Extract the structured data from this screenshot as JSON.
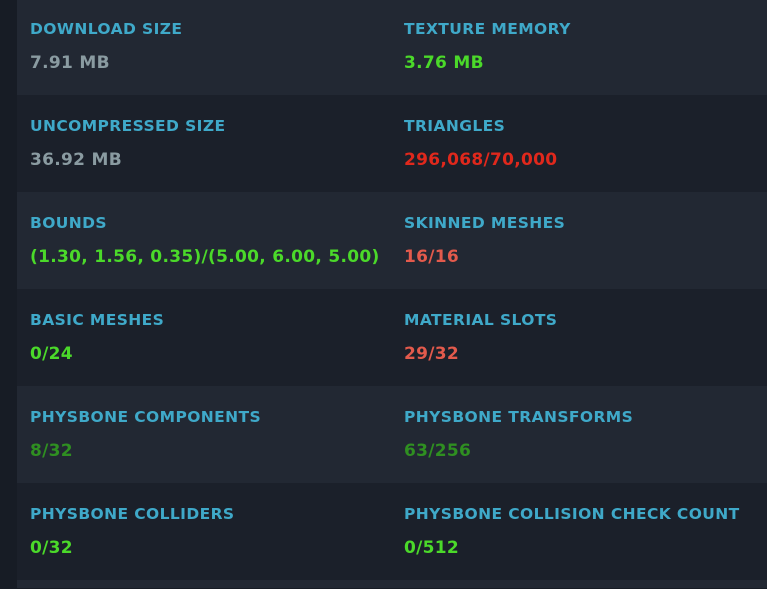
{
  "colors": {
    "label": "#3fa9c9",
    "neutral": "#8a9ba1",
    "good": "#4bd92a",
    "ok": "#2f8f21",
    "warn": "#e35a4c",
    "bad": "#e0281c"
  },
  "stats": [
    {
      "left": {
        "label": "DOWNLOAD SIZE",
        "value": "7.91 MB",
        "status": "neutral"
      },
      "right": {
        "label": "TEXTURE MEMORY",
        "value": "3.76 MB",
        "status": "good"
      }
    },
    {
      "left": {
        "label": "UNCOMPRESSED SIZE",
        "value": "36.92 MB",
        "status": "neutral"
      },
      "right": {
        "label": "TRIANGLES",
        "value": "296,068/70,000",
        "status": "bad"
      }
    },
    {
      "left": {
        "label": "BOUNDS",
        "value": "(1.30, 1.56, 0.35)/(5.00, 6.00, 5.00)",
        "status": "good"
      },
      "right": {
        "label": "SKINNED MESHES",
        "value": "16/16",
        "status": "warn"
      }
    },
    {
      "left": {
        "label": "BASIC MESHES",
        "value": "0/24",
        "status": "good"
      },
      "right": {
        "label": "MATERIAL SLOTS",
        "value": "29/32",
        "status": "warn"
      }
    },
    {
      "left": {
        "label": "PHYSBONE COMPONENTS",
        "value": "8/32",
        "status": "ok"
      },
      "right": {
        "label": "PHYSBONE TRANSFORMS",
        "value": "63/256",
        "status": "ok"
      }
    },
    {
      "left": {
        "label": "PHYSBONE COLLIDERS",
        "value": "0/32",
        "status": "good"
      },
      "right": {
        "label": "PHYSBONE COLLISION CHECK COUNT",
        "value": "0/512",
        "status": "good"
      }
    }
  ]
}
